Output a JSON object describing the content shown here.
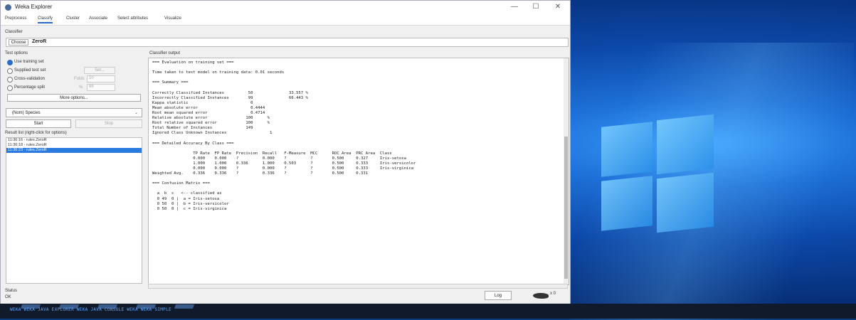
{
  "window": {
    "title": "Weka Explorer",
    "minimize": "—",
    "maximize": "☐",
    "close": "✕"
  },
  "tabs": [
    "Preprocess",
    "Classify",
    "Cluster",
    "Associate",
    "Select attributes",
    "Visualize"
  ],
  "classifier": {
    "section_label": "Classifier",
    "choose_label": "Choose",
    "value": "ZeroR"
  },
  "test_options": {
    "label": "Test options",
    "use_training": "Use training set",
    "supplied": "Supplied test set",
    "set_label": "Set...",
    "cross": "Cross-validation",
    "folds_label": "Folds",
    "folds_value": "10",
    "percentage": "Percentage split",
    "pct_symbol": "%",
    "pct_value": "66",
    "more_options": "More options..."
  },
  "class_select": "(Nom) Species",
  "start_label": "Start",
  "stop_label": "Stop",
  "result_list": {
    "label": "Result list (right-click for options)",
    "items": [
      "11:36:16 - rules.ZeroR",
      "11:36:18 - rules.ZeroR",
      "11:36:23 - rules.ZeroR"
    ]
  },
  "output": {
    "label": "Classifier output",
    "text": "=== Evaluation on training set ===\n\nTime taken to test model on training data: 0.01 seconds\n\n=== Summary ===\n\nCorrectly Classified Instances          50               33.557 %\nIncorrectly Classified Instances        99               66.443 %\nKappa statistic                          0\nMean absolute error                      0.4444\nRoot mean squared error                  0.4714\nRelative absolute error                100      %\nRoot relative squared error            100      %\nTotal Number of Instances              149\nIgnored Class Unknown Instances                  1\n\n=== Detailed Accuracy By Class ===\n\n                 TP Rate  FP Rate  Precision  Recall   F-Measure  MCC      ROC Area  PRC Area  Class\n                 0.000    0.000    ?          0.000    ?          ?        0.500     0.327     Iris-setosa\n                 1.000    1.000    0.336      1.000    0.503      ?        0.500     0.333     Iris-versicolor\n                 0.000    0.000    ?          0.000    ?          ?        0.500     0.333     Iris-virginica\nWeighted Avg.    0.336    0.336    ?          0.336    ?          ?        0.500     0.331\n\n=== Confusion Matrix ===\n\n  a  b  c   <-- classified as\n  0 49  0 |  a = Iris-setosa\n  0 50  0 |  b = Iris-versicolor\n  0 50  0 |  c = Iris-virginica"
  },
  "status": {
    "label": "Status",
    "value": "OK",
    "log_label": "Log",
    "x_count": "x 0"
  },
  "taskbar": {
    "text": "WEKA  WEKA JAVA  EXPLORER  WEKA JAVA  CONSOLE  WEKA  WEKA  SIMPLE"
  }
}
